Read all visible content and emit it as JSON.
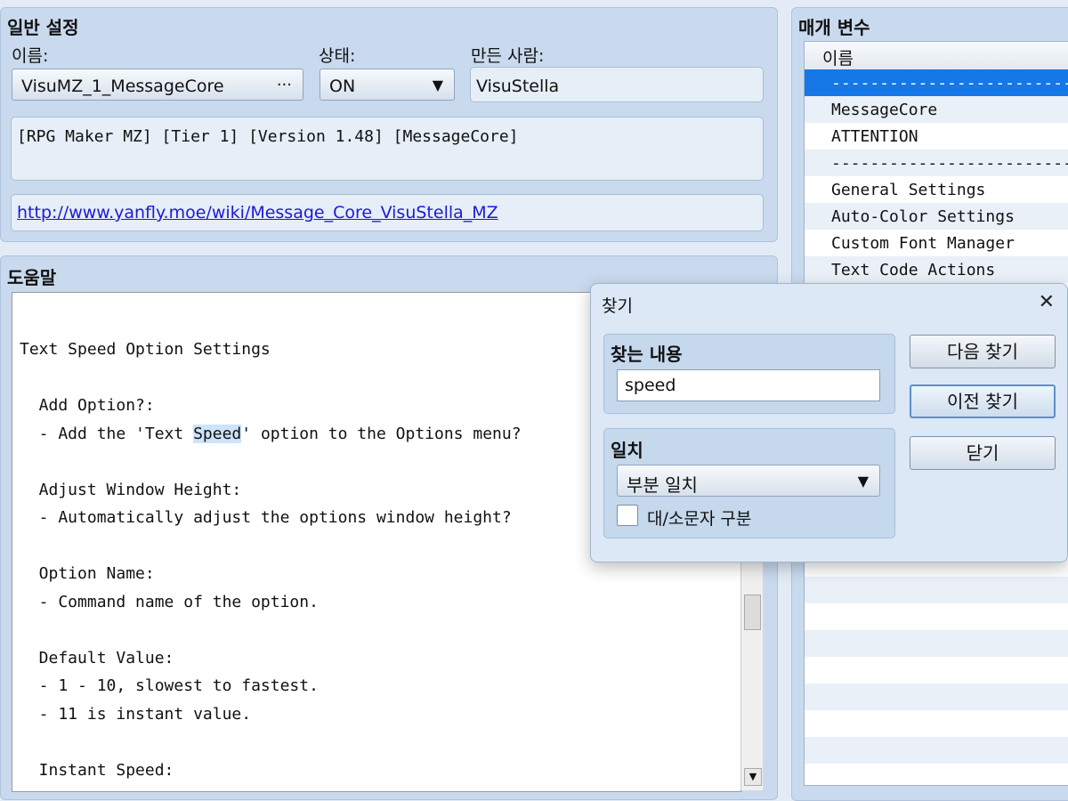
{
  "general": {
    "heading": "일반 설정",
    "name_label": "이름:",
    "name_value": "VisuMZ_1_MessageCore",
    "name_button": "···",
    "status_label": "상태:",
    "status_value": "ON",
    "author_label": "만든 사람:",
    "author_value": "VisuStella",
    "description": "[RPG Maker MZ] [Tier 1] [Version 1.48] [MessageCore]",
    "url": "http://www.yanfly.moe/wiki/Message_Core_VisuStella_MZ"
  },
  "help": {
    "heading": "도움말",
    "lines": [
      "Text Speed Option Settings",
      "  Add Option?:",
      "  - Add the 'Text ",
      "Speed",
      "' option to the Options menu?",
      "  Adjust Window Height:",
      "  - Automatically adjust the options window height?",
      "  Option Name:",
      "  - Command name of the option.",
      "  Default Value:",
      "  - 1 - 10, slowest to fastest.",
      "  - 11 is instant value.",
      "  Instant Speed:"
    ]
  },
  "params": {
    "heading": "매개 변수",
    "column_header": "이름",
    "items": [
      "------------------------------",
      "MessageCore",
      "ATTENTION",
      "------------------------------",
      "General Settings",
      "Auto-Color Settings",
      "Custom Font Manager",
      "Text Code Actions"
    ]
  },
  "find_dialog": {
    "title": "찾기",
    "close_glyph": "✕",
    "search_label": "찾는 내용",
    "search_value": "speed",
    "match_label": "일치",
    "match_value": "부분 일치",
    "case_label": "대/소문자 구분",
    "case_checked": false,
    "btn_next": "다음 찾기",
    "btn_prev": "이전 찾기",
    "btn_close": "닫기"
  },
  "colors": {
    "accent": "#1677e6",
    "panel": "#c9daee",
    "link": "#1a1adb"
  },
  "icons": {
    "dropdown": "▼",
    "scroll_down": "▼"
  }
}
